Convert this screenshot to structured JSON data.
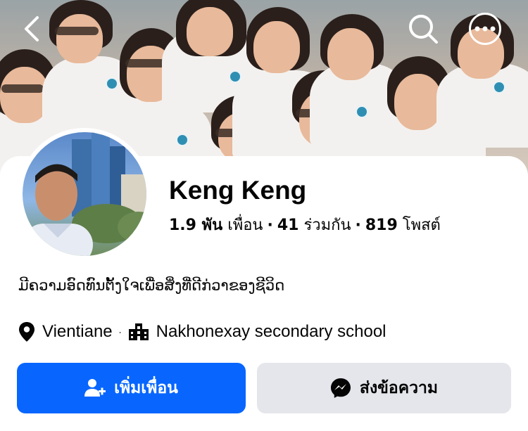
{
  "profile": {
    "name": "Keng Keng",
    "stats": {
      "friends_count": "1.9 พัน",
      "friends_label": "เพื่อน",
      "mutual_count": "41",
      "mutual_label": "ร่วมกัน",
      "posts_count": "819",
      "posts_label": "โพสต์"
    },
    "bio": "ມີຄວາມອົດທົນຕັ້ງໃຈເພື່ອສິ່ງທີ່ດີກ່ວາຂອງຊີວິດ",
    "location": "Vientiane",
    "school": "Nakhonexay secondary school"
  },
  "actions": {
    "add_friend_label": "เพิ่มเพื่อน",
    "message_label": "ส่งข้อความ"
  },
  "icons": {
    "back": "back-arrow-icon",
    "search": "search-icon",
    "more": "more-icon",
    "location": "location-pin-icon",
    "school": "school-building-icon",
    "add_friend": "add-friend-icon",
    "messenger": "messenger-icon"
  },
  "colors": {
    "primary": "#0866ff",
    "secondary_button": "#e4e6eb",
    "text": "#050505",
    "muted": "#65676b"
  }
}
